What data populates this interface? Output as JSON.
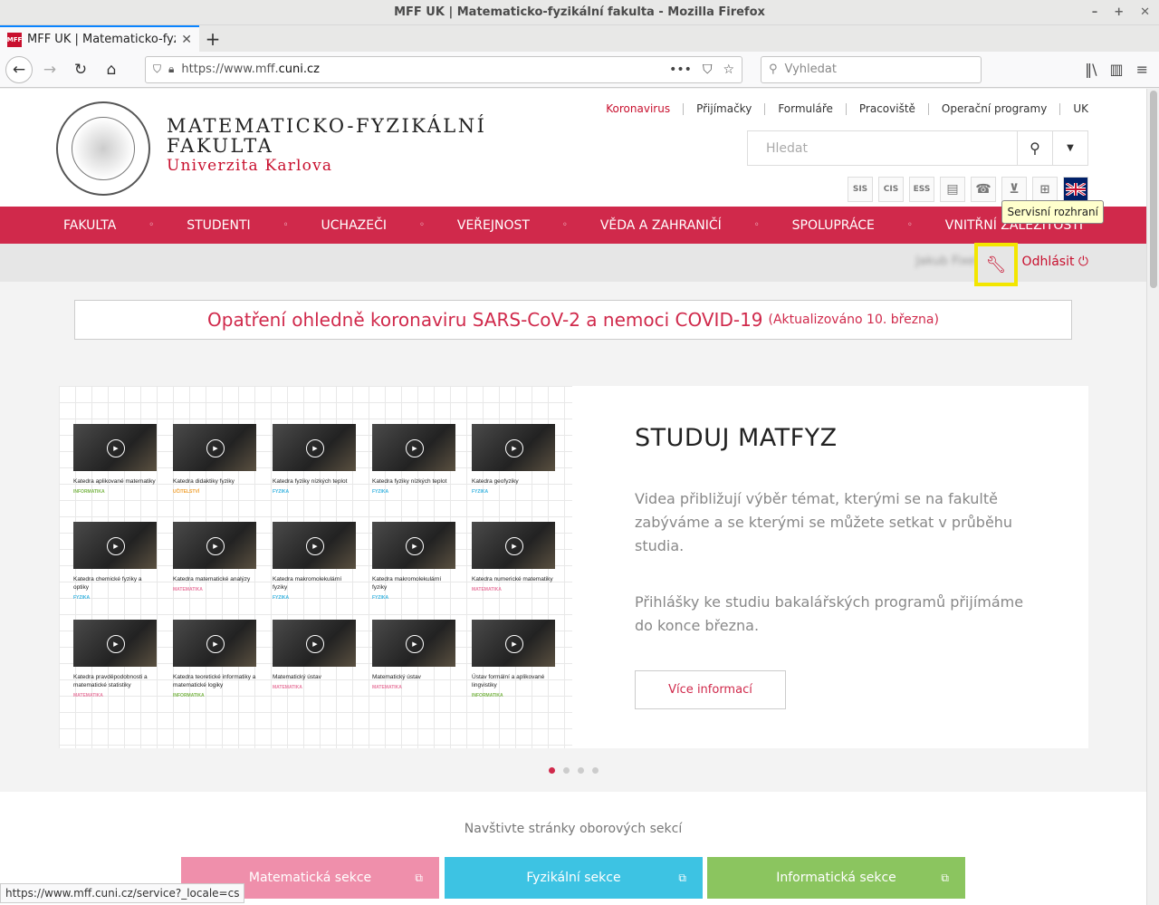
{
  "browser": {
    "window_title": "MFF UK | Matematicko-fyzikální fakulta - Mozilla Firefox",
    "tab_title": "MFF UK | Matematicko-fyzikál",
    "favicon_text": "MFF",
    "url_prefix": "https://www.mff.",
    "url_domain": "cuni.cz",
    "search_placeholder": "Vyhledat",
    "status_url": "https://www.mff.cuni.cz/service?_locale=cs"
  },
  "header": {
    "logo_line1": "MATEMATICKO-FYZIKÁLNÍ",
    "logo_line2": "FAKULTA",
    "logo_line3": "Univerzita Karlova",
    "toplinks": [
      "Koronavirus",
      "Přijímačky",
      "Formuláře",
      "Pracoviště",
      "Operační programy",
      "UK"
    ],
    "search_placeholder": "Hledat",
    "quick_icons": [
      "SIS",
      "CIS",
      "ESS",
      "book-icon",
      "phone-icon",
      "basket-icon",
      "sitemap-icon",
      "uk-flag-icon"
    ]
  },
  "mainnav": [
    "FAKULTA",
    "STUDENTI",
    "UCHAZEČI",
    "VEŘEJNOST",
    "VĚDA A ZAHRANIČÍ",
    "SPOLUPRÁCE",
    "VNITŘNÍ ZÁLEŽITOSTI"
  ],
  "userbar": {
    "username": "Jakub Fixel",
    "logout": "Odhlásit",
    "tooltip": "Servisní rozhraní"
  },
  "covid": {
    "text": "Opatření ohledně koronaviru SARS-CoV-2 a nemoci COVID-19",
    "updated": "(Aktualizováno 10. března)"
  },
  "slide": {
    "title": "STUDUJ MATFYZ",
    "p1": "Videa přibližují výběr témat, kterými se na fakultě zabýváme a se kterými se můžete setkat v průběhu studia.",
    "p2": "Přihlášky ke studiu bakalářských programů přijímáme do konce března.",
    "button": "Více informací",
    "videos": [
      {
        "title": "Katedra aplikované matematiky",
        "tag": "INFORMATIKA",
        "color": "#7ab648"
      },
      {
        "title": "Katedra didaktiky fyziky",
        "tag": "UČITELSTVÍ",
        "color": "#f0a030"
      },
      {
        "title": "Katedra fyziky nízkých teplot",
        "tag": "FYZIKA",
        "color": "#3ab4e0"
      },
      {
        "title": "Katedra fyziky nízkých teplot",
        "tag": "FYZIKA",
        "color": "#3ab4e0"
      },
      {
        "title": "Katedra geofyziky",
        "tag": "FYZIKA",
        "color": "#3ab4e0"
      },
      {
        "title": "Katedra chemické fyziky a optiky",
        "tag": "FYZIKA",
        "color": "#3ab4e0"
      },
      {
        "title": "Katedra matematické analýzy",
        "tag": "MATEMATIKA",
        "color": "#e87ba0"
      },
      {
        "title": "Katedra makromolekulární fyziky",
        "tag": "FYZIKA",
        "color": "#3ab4e0"
      },
      {
        "title": "Katedra makromolekulární fyziky",
        "tag": "FYZIKA",
        "color": "#3ab4e0"
      },
      {
        "title": "Katedra numerické matematiky",
        "tag": "MATEMATIKA",
        "color": "#e87ba0"
      },
      {
        "title": "Katedra pravděpodobnosti a matematické statistiky",
        "tag": "MATEMATIKA",
        "color": "#e87ba0"
      },
      {
        "title": "Katedra teoretické informatiky a matematické logiky",
        "tag": "INFORMATIKA",
        "color": "#7ab648"
      },
      {
        "title": "Matematický ústav",
        "tag": "MATEMATIKA",
        "color": "#e87ba0"
      },
      {
        "title": "Matematický ústav",
        "tag": "MATEMATIKA",
        "color": "#e87ba0"
      },
      {
        "title": "Ústav formální a aplikované lingvistiky",
        "tag": "INFORMATIKA",
        "color": "#7ab648"
      }
    ]
  },
  "sections": {
    "label": "Navštivte stránky oborových sekcí",
    "buttons": [
      {
        "label": "Matematická sekce",
        "color": "#ef8fab"
      },
      {
        "label": "Fyzikální sekce",
        "color": "#3dc3e3"
      },
      {
        "label": "Informatická sekce",
        "color": "#8bc55f"
      }
    ]
  },
  "colors": {
    "accent": "#d0294b",
    "highlight": "#f3e600"
  }
}
